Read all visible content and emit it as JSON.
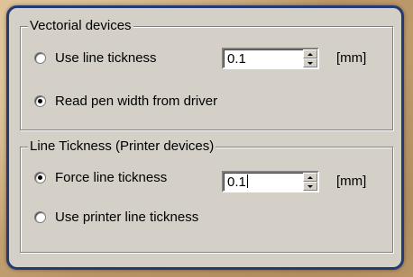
{
  "vectorial_group": {
    "title": "Vectorial devices",
    "use_line_thickness_label": "Use line tickness",
    "line_thickness_value": "0.1",
    "unit": "[mm]",
    "read_pen_width_label": "Read pen width from driver",
    "selected": "read_pen_width"
  },
  "printer_group": {
    "title": "Line Tickness (Printer devices)",
    "force_line_thickness_label": "Force line tickness",
    "line_thickness_value": "0.1",
    "unit": "[mm]",
    "use_printer_thickness_label": "Use printer line tickness",
    "selected": "force_line_thickness"
  }
}
